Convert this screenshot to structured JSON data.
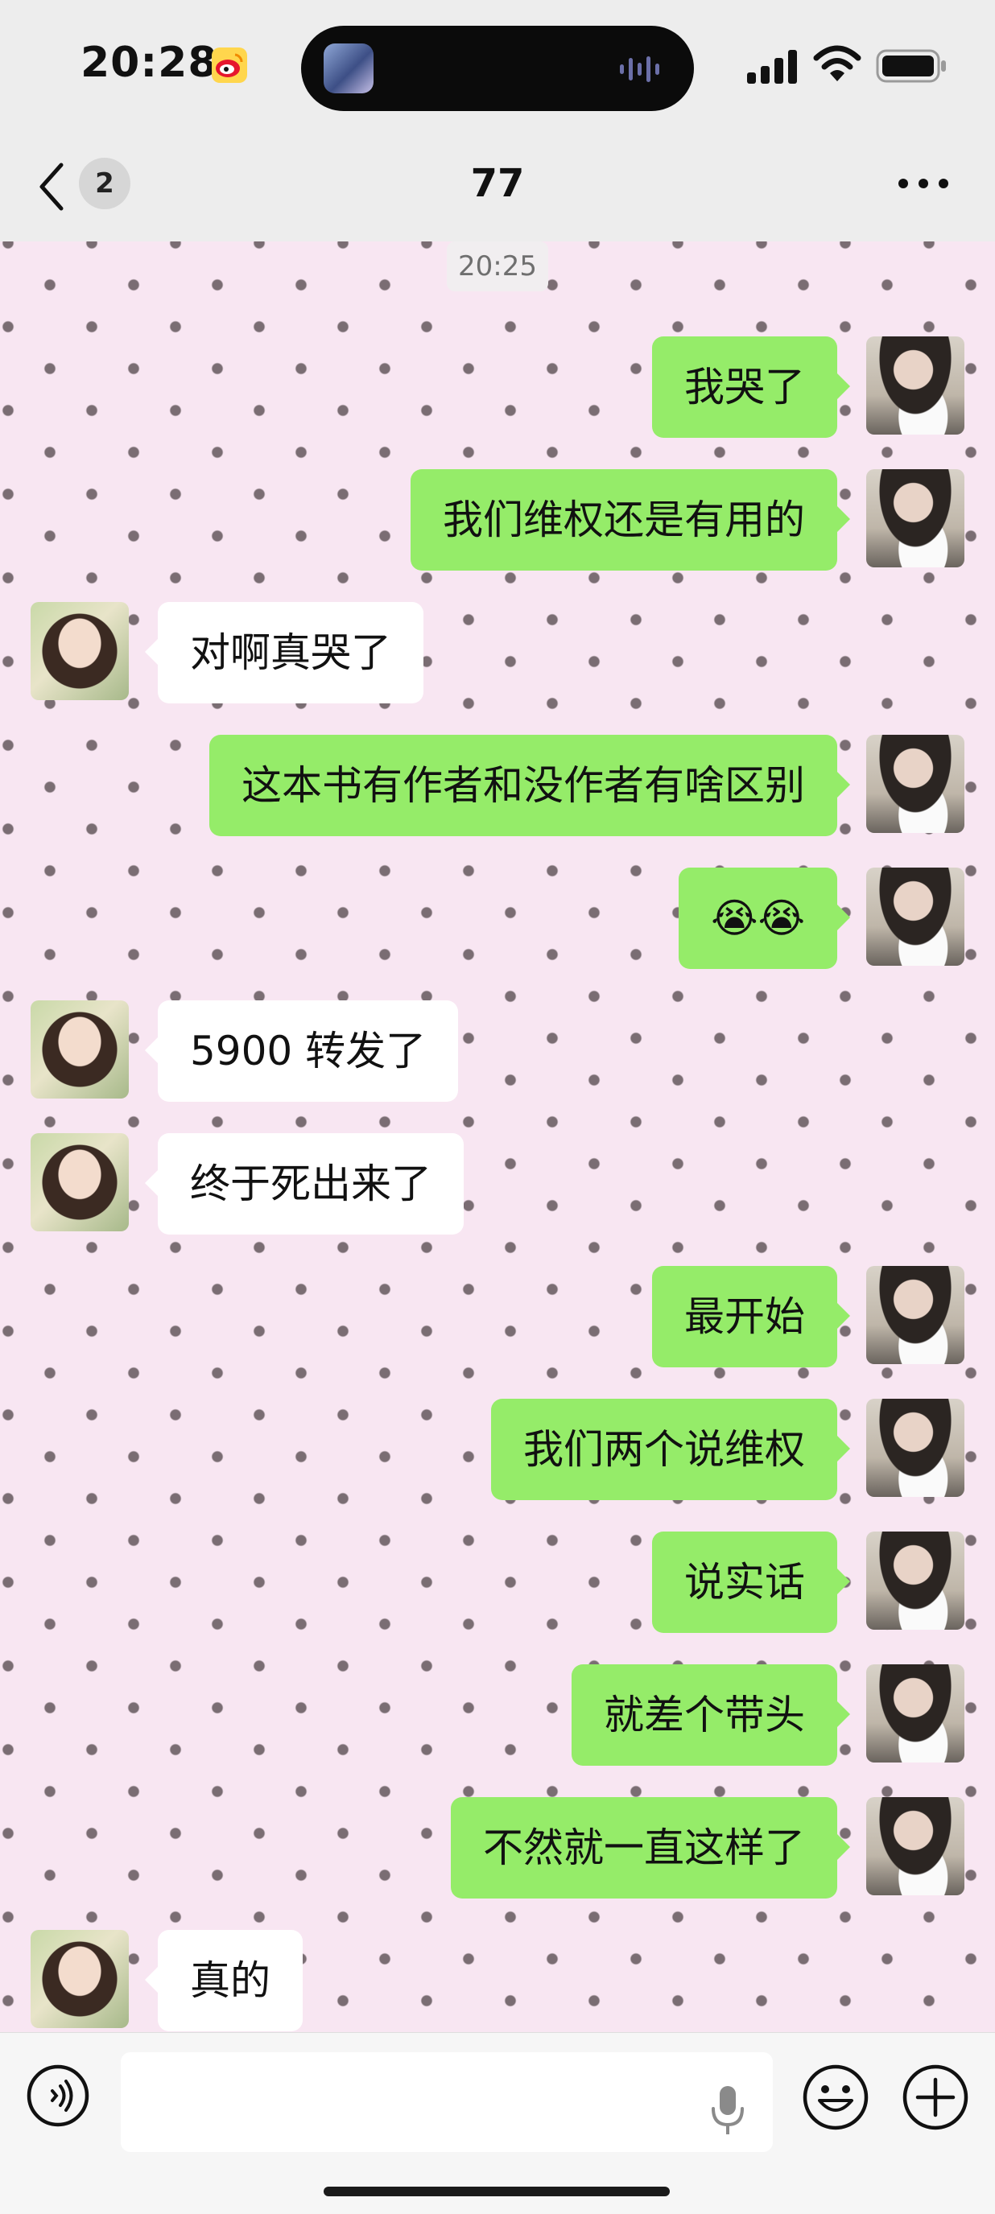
{
  "status": {
    "time": "20:28"
  },
  "nav": {
    "unread": "2",
    "title": "77"
  },
  "chat": {
    "timestamp": "20:25",
    "messages": [
      {
        "side": "right",
        "text": "我哭了"
      },
      {
        "side": "right",
        "text": "我们维权还是有用的"
      },
      {
        "side": "left",
        "text": "对啊真哭了"
      },
      {
        "side": "right",
        "text": "这本书有作者和没作者有啥区别"
      },
      {
        "side": "right",
        "text": "😭😭"
      },
      {
        "side": "left",
        "text": "5900 转发了"
      },
      {
        "side": "left",
        "text": "终于死出来了"
      },
      {
        "side": "right",
        "text": "最开始"
      },
      {
        "side": "right",
        "text": "我们两个说维权"
      },
      {
        "side": "right",
        "text": "说实话"
      },
      {
        "side": "right",
        "text": "就差个带头"
      },
      {
        "side": "right",
        "text": "不然就一直这样了"
      },
      {
        "side": "left",
        "text": "真的"
      }
    ]
  },
  "input": {
    "value": ""
  },
  "icons": [
    "back-chevron-icon",
    "more-icon",
    "voice-icon",
    "mic-icon",
    "emoji-icon",
    "plus-icon",
    "signal-icon",
    "wifi-icon",
    "battery-icon",
    "weibo-icon"
  ],
  "colors": {
    "self_bubble": "#95ec69",
    "other_bubble": "#ffffff",
    "chat_background": "#f8e6f2"
  }
}
